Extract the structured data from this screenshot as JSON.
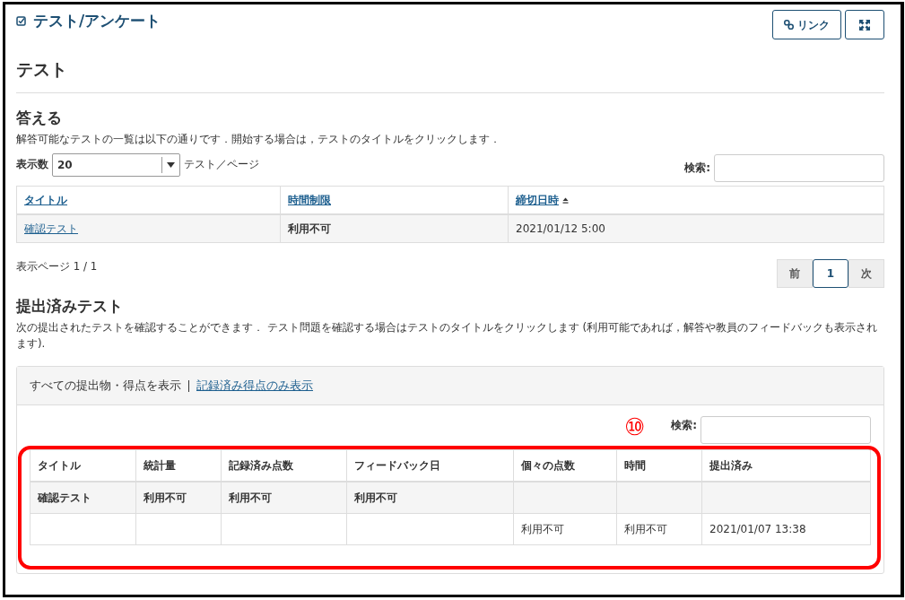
{
  "tool_title": "テスト/アンケート",
  "buttons": [
    {
      "kind": "link",
      "label": "リンク"
    },
    {
      "kind": "expand"
    }
  ],
  "page_heading": "テスト",
  "answer_section": {
    "heading": "答える",
    "description": "解答可能なテストの一覧は以下の通りです．開始する場合は，テストのタイトルをクリックします．",
    "page_size": {
      "label": "表示数",
      "value": "20",
      "suffix": "テスト／ページ"
    },
    "search_label": "検索:",
    "columns": [
      {
        "label": "タイトル",
        "sorted": false
      },
      {
        "label": "時間制限",
        "sorted": false
      },
      {
        "label": "締切日時",
        "sorted": true
      }
    ],
    "rows": [
      [
        "確認テスト",
        "利用不可",
        "2021/01/12 5:00"
      ]
    ],
    "page_info": "表示ページ 1 / 1",
    "pagination": [
      {
        "label": "前",
        "selected": false
      },
      {
        "label": "1",
        "selected": true
      },
      {
        "label": "次",
        "selected": false
      }
    ]
  },
  "submitted_section": {
    "heading": "提出済みテスト",
    "description": "次の提出されたテストを確認することができます． テスト問題を確認する場合はテストのタイトルをクリックします (利用可能であれば，解答や教員のフィードバックも表示されます).",
    "filters": [
      {
        "label": "すべての提出物・得点を表示",
        "selected": true
      },
      {
        "label": "記録済み得点のみ表示",
        "selected": false
      }
    ],
    "search_label": "検索:",
    "columns": [
      "タイトル",
      "統計量",
      "記録済み点数",
      "フィードバック日",
      "個々の点数",
      "時間",
      "提出済み"
    ],
    "rows": [
      {
        "kind": "test",
        "cells": [
          "確認テスト",
          "利用不可",
          "利用不可",
          "利用不可",
          "",
          "",
          ""
        ]
      },
      {
        "kind": "submission",
        "cells": [
          "",
          "",
          "",
          "",
          "利用不可",
          "利用不可",
          "2021/01/07 13:38"
        ]
      }
    ]
  },
  "annotation": {
    "label": "⑩"
  }
}
